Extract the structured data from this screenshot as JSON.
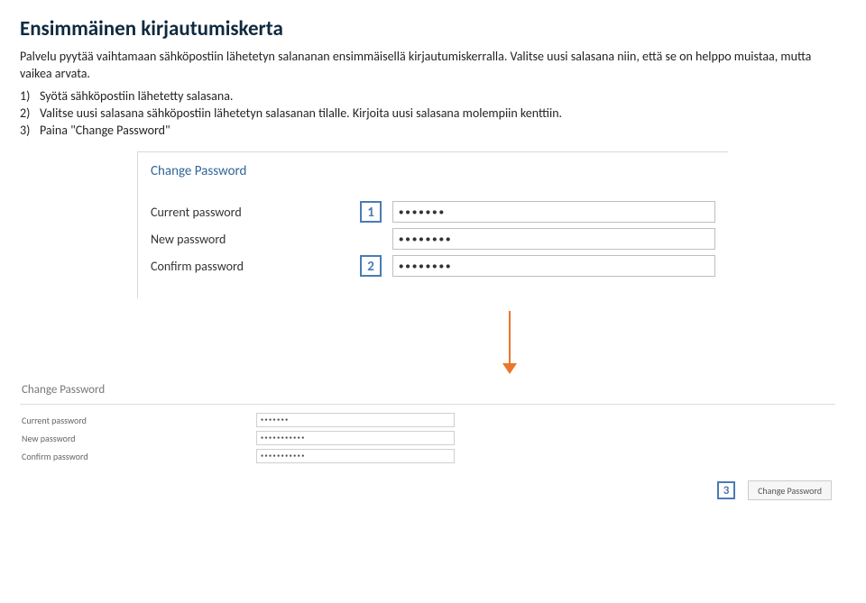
{
  "heading": "Ensimmäinen kirjautumiskerta",
  "intro": "Palvelu pyytää vaihtamaan sähköpostiin lähetetyn salananan ensimmäisellä kirjautumiskerralla. Valitse uusi salasana niin, että se on helppo muistaa, mutta vaikea arvata.",
  "steps": [
    {
      "n": "1)",
      "text": "Syötä sähköpostiin lähetetty salasana."
    },
    {
      "n": "2)",
      "text": "Valitse uusi salasana sähköpostiin lähetetyn salasanan tilalle. Kirjoita uusi salasana molempiin kenttiin."
    },
    {
      "n": "3)",
      "text": "Paina \"Change Password\""
    }
  ],
  "panel1": {
    "title": "Change Password",
    "marker1": "1",
    "marker2": "2",
    "fields": {
      "current": {
        "label": "Current password",
        "value": "●●●●●●●"
      },
      "new": {
        "label": "New password",
        "value": "●●●●●●●●"
      },
      "confirm": {
        "label": "Confirm password",
        "value": "●●●●●●●●"
      }
    }
  },
  "panel2": {
    "title": "Change Password",
    "fields": {
      "current": {
        "label": "Current password",
        "value": "●●●●●●●"
      },
      "new": {
        "label": "New password",
        "value": "●●●●●●●●●●●"
      },
      "confirm": {
        "label": "Confirm password",
        "value": "●●●●●●●●●●●"
      }
    },
    "marker3": "3",
    "button": "Change Password"
  }
}
